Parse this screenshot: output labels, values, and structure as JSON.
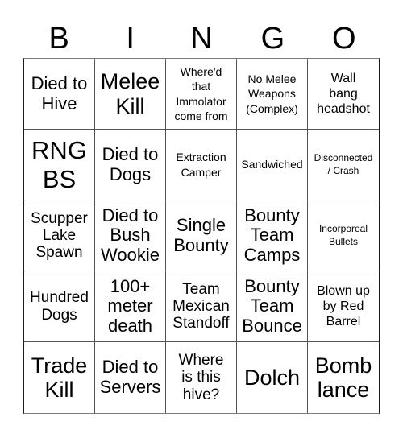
{
  "header": {
    "letters": [
      "B",
      "I",
      "N",
      "G",
      "O"
    ]
  },
  "cells": [
    {
      "text": "Died to\nHive",
      "size": "fs-m"
    },
    {
      "text": "Melee\nKill",
      "size": "fs-l"
    },
    {
      "text": "Where'd\nthat\nImmolator\ncome from",
      "size": "fs-xs"
    },
    {
      "text": "No Melee\nWeapons\n(Complex)",
      "size": "fs-xs"
    },
    {
      "text": "Wall\nbang\nheadshot",
      "size": "fs-s"
    },
    {
      "text": "RNG\nBS",
      "size": "fs-xl"
    },
    {
      "text": "Died to\nDogs",
      "size": "fs-m"
    },
    {
      "text": "Extraction\nCamper",
      "size": "fs-xs"
    },
    {
      "text": "Sandwiched",
      "size": "fs-xs"
    },
    {
      "text": "Disconnected\n/ Crash",
      "size": "fs-xxs"
    },
    {
      "text": "Scupper\nLake\nSpawn",
      "size": "fs-ms"
    },
    {
      "text": "Died to\nBush\nWookie",
      "size": "fs-m"
    },
    {
      "text": "Single\nBounty",
      "size": "fs-m"
    },
    {
      "text": "Bounty\nTeam\nCamps",
      "size": "fs-m"
    },
    {
      "text": "Incorporeal\nBullets",
      "size": "fs-xxs"
    },
    {
      "text": "Hundred\nDogs",
      "size": "fs-ms"
    },
    {
      "text": "100+\nmeter\ndeath",
      "size": "fs-m"
    },
    {
      "text": "Team\nMexican\nStandoff",
      "size": "fs-ms"
    },
    {
      "text": "Bounty\nTeam\nBounce",
      "size": "fs-m"
    },
    {
      "text": "Blown up\nby Red\nBarrel",
      "size": "fs-s"
    },
    {
      "text": "Trade\nKill",
      "size": "fs-l"
    },
    {
      "text": "Died to\nServers",
      "size": "fs-m"
    },
    {
      "text": "Where\nis this\nhive?",
      "size": "fs-ms"
    },
    {
      "text": "Dolch",
      "size": "fs-l"
    },
    {
      "text": "Bomb\nlance",
      "size": "fs-l"
    }
  ]
}
